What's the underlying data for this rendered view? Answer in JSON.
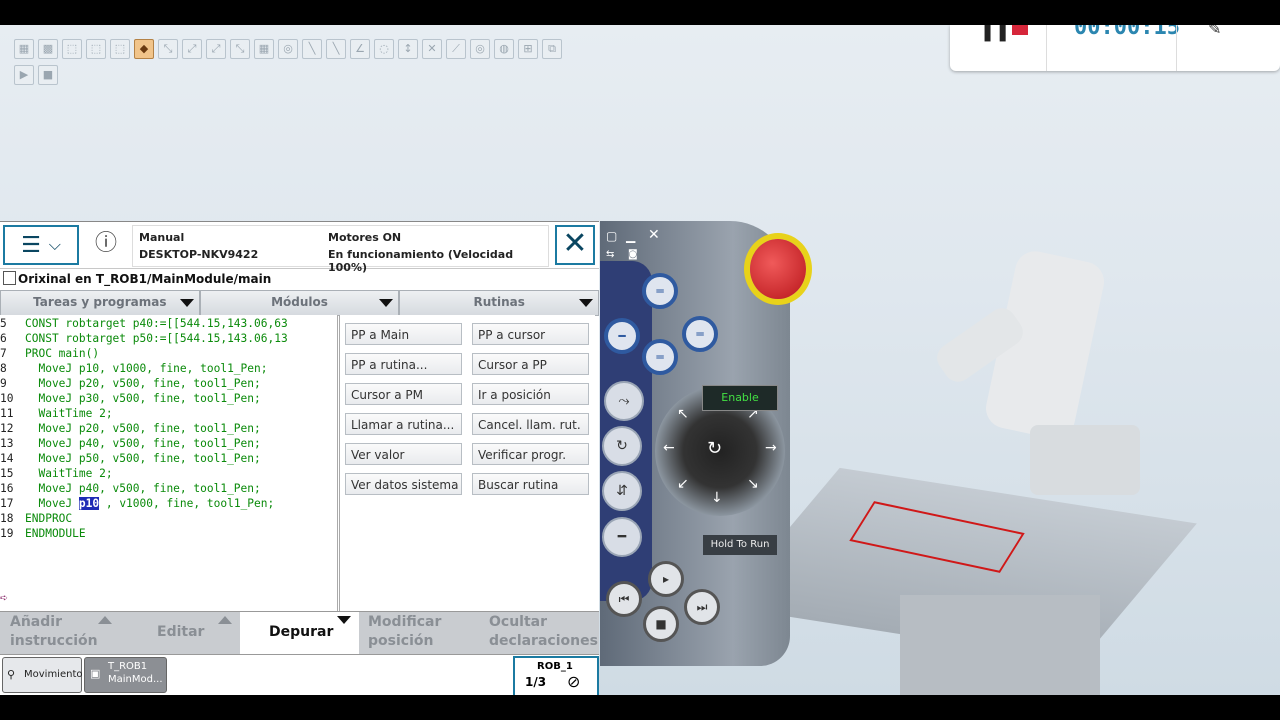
{
  "recording": {
    "time": "00:00:15"
  },
  "pendant": {
    "header": {
      "mode": "Manual",
      "controller": "DESKTOP-NKV9422",
      "motors": "Motores ON",
      "state": "En funcionamiento (Velocidad 100%)"
    },
    "window_title": "Orixinal en T_ROB1/MainModule/main",
    "tabs": [
      "Tareas y programas",
      "Módulos",
      "Rutinas"
    ],
    "code_lines": [
      {
        "n": "5",
        "text": "CONST robtarget p40:=[[544.15,143.06,63"
      },
      {
        "n": "6",
        "text": "CONST robtarget p50:=[[544.15,143.06,13"
      },
      {
        "n": "7",
        "text": "PROC main()"
      },
      {
        "n": "8",
        "text": "  MoveJ p10, v1000, fine, tool1_Pen;"
      },
      {
        "n": "9",
        "text": "  MoveJ p20, v500, fine, tool1_Pen;"
      },
      {
        "n": "10",
        "text": "  MoveJ p30, v500, fine, tool1_Pen;"
      },
      {
        "n": "11",
        "text": "  WaitTime 2;"
      },
      {
        "n": "12",
        "text": "  MoveJ p20, v500, fine, tool1_Pen;"
      },
      {
        "n": "13",
        "text": "  MoveJ p40, v500, fine, tool1_Pen;"
      },
      {
        "n": "14",
        "text": "  MoveJ p50, v500, fine, tool1_Pen;"
      },
      {
        "n": "15",
        "text": "  WaitTime 2;"
      },
      {
        "n": "16",
        "text": "  MoveJ p40, v500, fine, tool1_Pen;"
      },
      {
        "n": "17",
        "pre": "  MoveJ ",
        "hl": "p10",
        "post": " , v1000, fine, tool1_Pen;"
      },
      {
        "n": "18",
        "text": "ENDPROC"
      },
      {
        "n": "19",
        "text": "ENDMODULE"
      }
    ],
    "debug_menu": [
      "PP a Main",
      "PP a cursor",
      "PP a rutina...",
      "Cursor a PP",
      "Cursor a PM",
      "Ir a posición",
      "Llamar a rutina...",
      "Cancel. llam. rut.",
      "Ver valor",
      "Verificar progr.",
      "Ver datos sistema",
      "Buscar rutina"
    ],
    "bottom_tabs": {
      "add_line1": "Añadir",
      "add_line2": "instrucción",
      "edit": "Editar",
      "debug": "Depurar",
      "modify_line1": "Modificar",
      "modify_line2": "posición",
      "hide_line1": "Ocultar",
      "hide_line2": "declaraciones"
    },
    "taskbar": {
      "jog": "Movimiento",
      "program_line1": "T_ROB1",
      "program_line2": "MainMod...",
      "rob": "ROB_1",
      "fraction": "1/3"
    }
  },
  "joystick": {
    "enable": "Enable",
    "hold_to_run": "Hold To Run"
  },
  "colors": {
    "accent": "#1b7aa1",
    "code": "#0a8a0a",
    "highlight": "#1f2bb5",
    "enable_text": "#43e043",
    "timer": "#2b86b0"
  }
}
